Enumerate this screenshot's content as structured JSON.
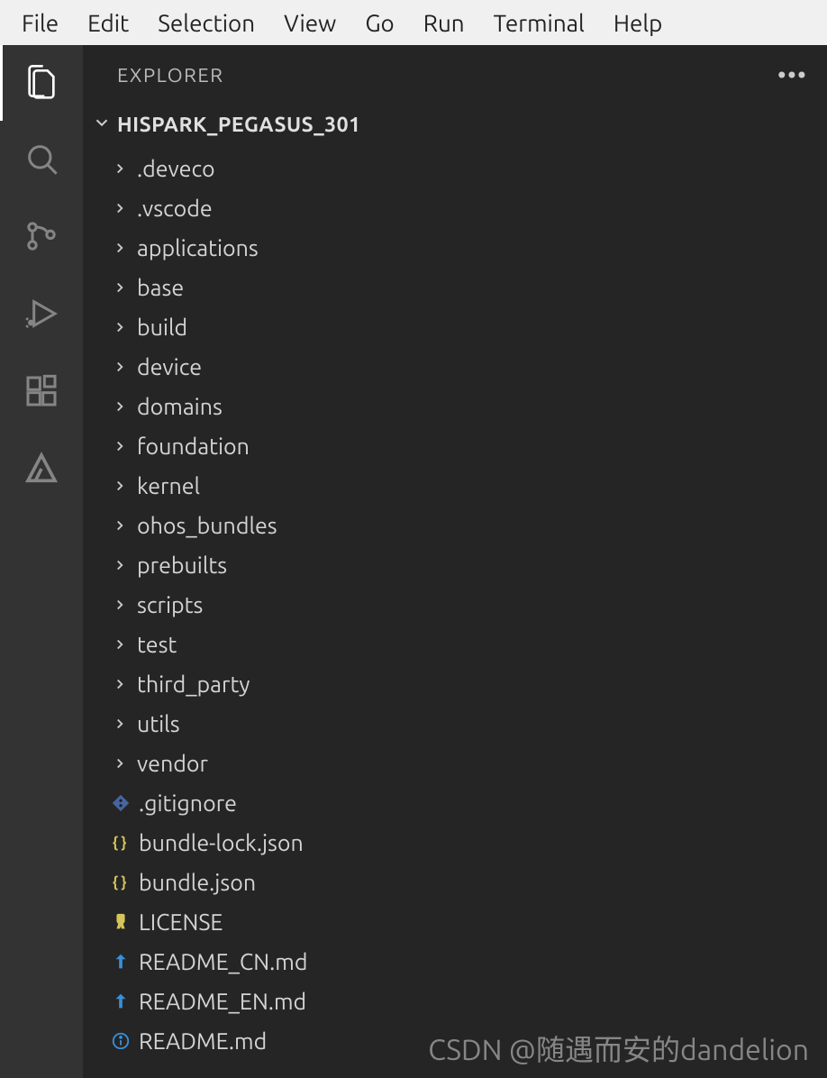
{
  "menubar": {
    "items": [
      "File",
      "Edit",
      "Selection",
      "View",
      "Go",
      "Run",
      "Terminal",
      "Help"
    ]
  },
  "sidebar": {
    "title": "EXPLORER",
    "section": "HISPARK_PEGASUS_301"
  },
  "tree": [
    {
      "type": "folder",
      "name": ".deveco"
    },
    {
      "type": "folder",
      "name": ".vscode"
    },
    {
      "type": "folder",
      "name": "applications"
    },
    {
      "type": "folder",
      "name": "base"
    },
    {
      "type": "folder",
      "name": "build"
    },
    {
      "type": "folder",
      "name": "device"
    },
    {
      "type": "folder",
      "name": "domains"
    },
    {
      "type": "folder",
      "name": "foundation"
    },
    {
      "type": "folder",
      "name": "kernel"
    },
    {
      "type": "folder",
      "name": "ohos_bundles"
    },
    {
      "type": "folder",
      "name": "prebuilts"
    },
    {
      "type": "folder",
      "name": "scripts"
    },
    {
      "type": "folder",
      "name": "test"
    },
    {
      "type": "folder",
      "name": "third_party"
    },
    {
      "type": "folder",
      "name": "utils"
    },
    {
      "type": "folder",
      "name": "vendor"
    },
    {
      "type": "file",
      "name": ".gitignore",
      "icon": "git"
    },
    {
      "type": "file",
      "name": "bundle-lock.json",
      "icon": "json"
    },
    {
      "type": "file",
      "name": "bundle.json",
      "icon": "json"
    },
    {
      "type": "file",
      "name": "LICENSE",
      "icon": "license"
    },
    {
      "type": "file",
      "name": "README_CN.md",
      "icon": "md"
    },
    {
      "type": "file",
      "name": "README_EN.md",
      "icon": "md"
    },
    {
      "type": "file",
      "name": "README.md",
      "icon": "info"
    }
  ],
  "watermark": "CSDN @随遇而安的dandelion"
}
